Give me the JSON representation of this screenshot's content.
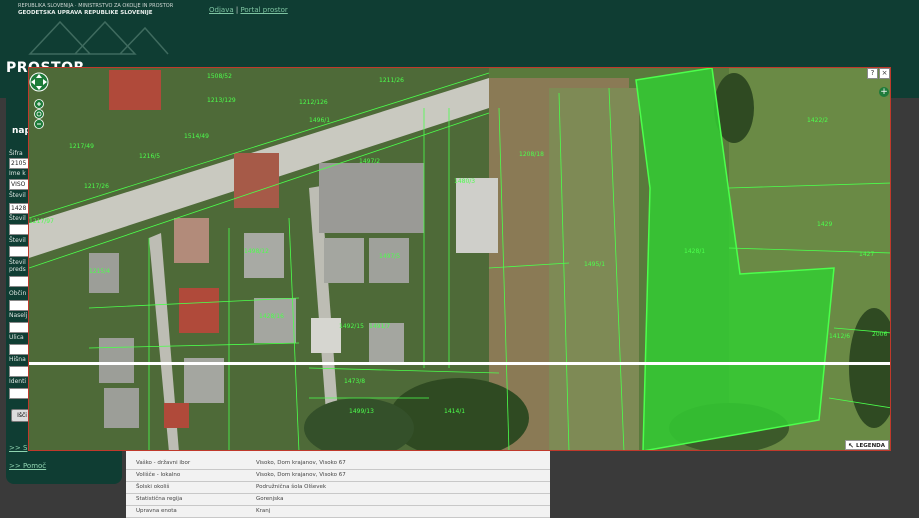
{
  "header": {
    "org_line1": "REPUBLIKA SLOVENIJA · MINISTRSTVO ZA OKOLJE IN PROSTOR",
    "org_line2": "GEODETSKA UPRAVA REPUBLIKE SLOVENIJE",
    "link_odjava": "Odjava",
    "separator": "|",
    "link_portal": "Portal prostor",
    "brand": "PROSTOR"
  },
  "sidebar": {
    "title": "nap",
    "fields": [
      {
        "label": "Šifra",
        "value": "2105"
      },
      {
        "label": "Ime k",
        "value": "VISO"
      },
      {
        "label": "Števil",
        "value": "1428"
      },
      {
        "label": "Števil",
        "value": ""
      },
      {
        "label": "Števil",
        "value": ""
      },
      {
        "label": "Števil preds",
        "value": ""
      },
      {
        "label": "Občin",
        "value": ""
      },
      {
        "label": "Naselj",
        "value": ""
      },
      {
        "label": "Ulica",
        "value": ""
      },
      {
        "label": "Hišna",
        "value": ""
      },
      {
        "label": "Identi",
        "value": ""
      }
    ],
    "search_button": "Išči",
    "link_s": ">> S",
    "help_link": ">> Pomoč"
  },
  "table": {
    "rows": [
      {
        "label": "Vaško - državni ibor",
        "value": "Visoko, Dom krajanov, Visoko 67"
      },
      {
        "label": "Volišče - lokalno",
        "value": "Visoko, Dom krajanov, Visoko 67"
      },
      {
        "label": "Šolski okoliš",
        "value": "Podružnična šola Olševek"
      },
      {
        "label": "Statistična regija",
        "value": "Gorenjska"
      },
      {
        "label": "Upravna enota",
        "value": "Kranj"
      }
    ]
  },
  "map": {
    "window_help": "?",
    "window_close": "×",
    "expand_button": "+",
    "legend_label": "LEGENDA",
    "parcel_labels": [
      "1508/52",
      "1213/129",
      "1212/126",
      "1211/26",
      "1514/49",
      "1216/5",
      "1217/26",
      "1496/1",
      "1497/2",
      "1217/97",
      "1498/12",
      "1215/4",
      "1208/18",
      "1495/1",
      "1217/49",
      "1428/1",
      "1429",
      "1422/2",
      "1427",
      "1428/16",
      "1492/15",
      "1473/8",
      "1499/13",
      "1412/6",
      "2006",
      "1414/1",
      "1480/3",
      "1491/7",
      "1497/5"
    ],
    "colors": {
      "selected_parcel": "#33cc33",
      "parcel_line": "#4cff4c",
      "frame": "#c0392b",
      "header_bg": "#0f3d33"
    }
  },
  "icons": [
    "pan-arrows-icon",
    "zoom-in-icon",
    "zoom-reset-icon",
    "zoom-out-icon",
    "help-icon",
    "close-icon",
    "plus-icon",
    "legend-arrow-icon"
  ]
}
